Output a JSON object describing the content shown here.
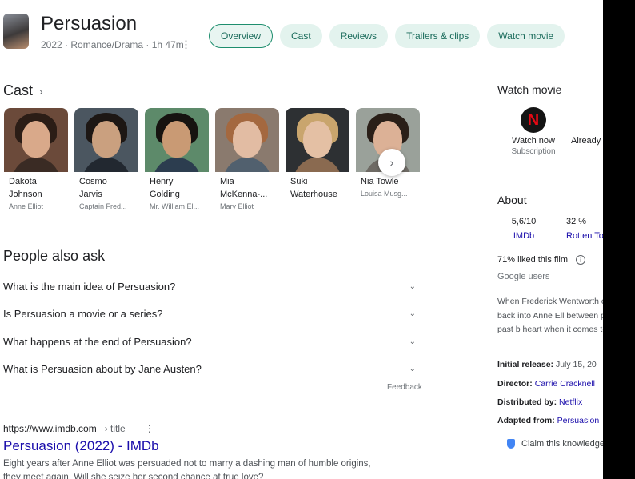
{
  "header": {
    "title": "Persuasion",
    "subtitle": "2022 · Romance/Drama · 1h 47m",
    "kebab": "⋮"
  },
  "tabs": [
    {
      "label": "Overview"
    },
    {
      "label": "Cast"
    },
    {
      "label": "Reviews"
    },
    {
      "label": "Trailers & clips"
    },
    {
      "label": "Watch movie"
    }
  ],
  "cast": {
    "heading": "Cast",
    "next_icon": "chevron-right-icon",
    "members": [
      {
        "name1": "Dakota",
        "name2": "Johnson",
        "role": "Anne Elliot"
      },
      {
        "name1": "Cosmo",
        "name2": "Jarvis",
        "role": "Captain Fred..."
      },
      {
        "name1": "Henry",
        "name2": "Golding",
        "role": "Mr. William El..."
      },
      {
        "name1": "Mia",
        "name2": "McKenna-...",
        "role": "Mary Elliot"
      },
      {
        "name1": "Suki",
        "name2": "Waterhouse",
        "role": ""
      },
      {
        "name1": "Nia Towle",
        "name2": "",
        "role": "Louisa Musg..."
      }
    ]
  },
  "paa": {
    "heading": "People also ask",
    "questions": [
      "What is the main idea of Persuasion?",
      "Is Persuasion a movie or a series?",
      "What happens at the end of Persuasion?",
      "What is Persuasion about by Jane Austen?"
    ],
    "feedback": "Feedback"
  },
  "result": {
    "domain": "https://www.imdb.com",
    "path": "› title",
    "title": "Persuasion (2022) - IMDb",
    "snippet": "Eight years after Anne Elliot was persuaded not to marry a dashing man of humble origins, they meet again. Will she seize her second chance at true love?"
  },
  "panel": {
    "watch_heading": "Watch movie",
    "providers": [
      {
        "name": "Watch now",
        "sub": "Subscription",
        "logo": "N"
      },
      {
        "name": "Already",
        "sub": ""
      }
    ],
    "about_heading": "About",
    "ratings": [
      {
        "score": "5,6/10",
        "source": "IMDb"
      },
      {
        "score": "32 %",
        "source": "Rotten To"
      }
    ],
    "liked": "71% liked this film",
    "liked_source": "Google users",
    "description": "When Frederick Wentworth crashes back into Anne Ell between putting the past b heart when it comes to sec",
    "facts": [
      {
        "label": "Initial release:",
        "value": "July 15, 20",
        "link": false
      },
      {
        "label": "Director:",
        "value": "Carrie Cracknell",
        "link": true
      },
      {
        "label": "Distributed by:",
        "value": "Netflix",
        "link": true
      },
      {
        "label": "Adapted from:",
        "value": "Persuasion",
        "link": true
      }
    ],
    "claim": "Claim this knowledge"
  },
  "colors": {
    "tab_bg": "#e3f3ee",
    "tab_text": "#1a6b5b",
    "link": "#1a0dab",
    "netflix_red": "#e50914"
  }
}
